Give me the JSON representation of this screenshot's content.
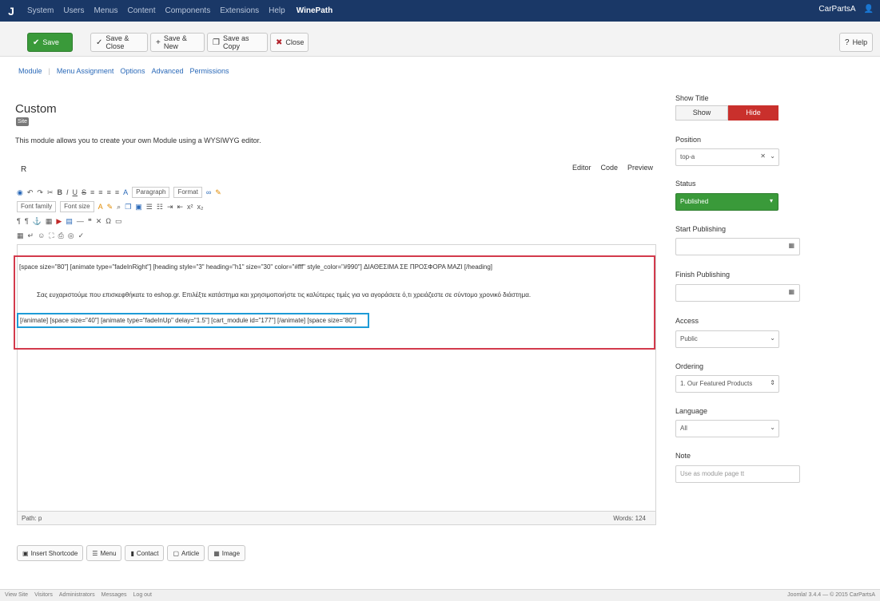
{
  "topbar": {
    "logo": "J",
    "menu": [
      "System",
      "Users",
      "Menus",
      "Content",
      "Components",
      "Extensions",
      "Help"
    ],
    "site_name": "WinePath",
    "user": "CarPartsA",
    "user_icon": "👤"
  },
  "toolbar": {
    "save": "Save",
    "save_close": "Save & Close",
    "save_new": "Save & New",
    "save_copy": "Save as Copy",
    "close": "Close",
    "help": "Help"
  },
  "tabs": [
    "Module",
    "Menu Assignment",
    "Options",
    "Advanced",
    "Permissions"
  ],
  "module": {
    "title": "Custom",
    "badge": "Site",
    "description": "This module allows you to create your own Module using a WYSIWYG editor.",
    "editor_label": "R"
  },
  "editor": {
    "mode_tabs": [
      "Editor",
      "Code",
      "Preview"
    ],
    "paragraph_select": "Paragraph",
    "format_select": "Format",
    "font_family_select": "Font family",
    "font_size_select": "Font size",
    "content": {
      "line1": "[space size=\"80\"] [animate type=\"fadeInRight\"] [heading style=\"3\" heading=\"h1\" size=\"30\" color=\"#fff\" style_color=\"#990\"] ΔΙΑΘΕΣΙΜΑ ΣΕ ΠΡΟΣΦΟΡΑ ΜΑΖΙ [/heading]",
      "line2": "Σας ευχαριστούμε που επισκεφθήκατε το eshop.gr. Επιλέξτε κατάστημα και χρησιμοποιήστε τις καλύτερες τιμές για να αγοράσετε ό,τι χρειάζεστε σε σύντομο χρονικό διάστημα.",
      "line3": "[/animate] [space size=\"40\"] [animate type=\"fadeInUp\" delay=\"1.5\"] [cart_module id=\"177\"] [/animate] [space size=\"80\"]"
    },
    "status_path": "Path: p",
    "status_words": "Words: 124"
  },
  "editor_buttons": [
    "Insert Shortcode",
    "Menu",
    "Contact",
    "Article",
    "Image"
  ],
  "sidebar": {
    "show_title_label": "Show Title",
    "show_label": "Show",
    "hide_label": "Hide",
    "position_label": "Position",
    "position_value": "top-a",
    "status_label": "Status",
    "status_value": "Published",
    "start_publishing_label": "Start Publishing",
    "finish_publishing_label": "Finish Publishing",
    "access_label": "Access",
    "access_value": "Public",
    "ordering_label": "Ordering",
    "ordering_value": "1. Our Featured Products",
    "language_label": "Language",
    "language_value": "All",
    "note_label": "Note",
    "note_placeholder": "Use as module page tt"
  },
  "footer": {
    "items": [
      "View Site",
      "Visitors",
      "Administrators",
      "Messages",
      "Log out"
    ],
    "right": "Joomla! 3.4.4 — © 2015 CarPartsA"
  }
}
